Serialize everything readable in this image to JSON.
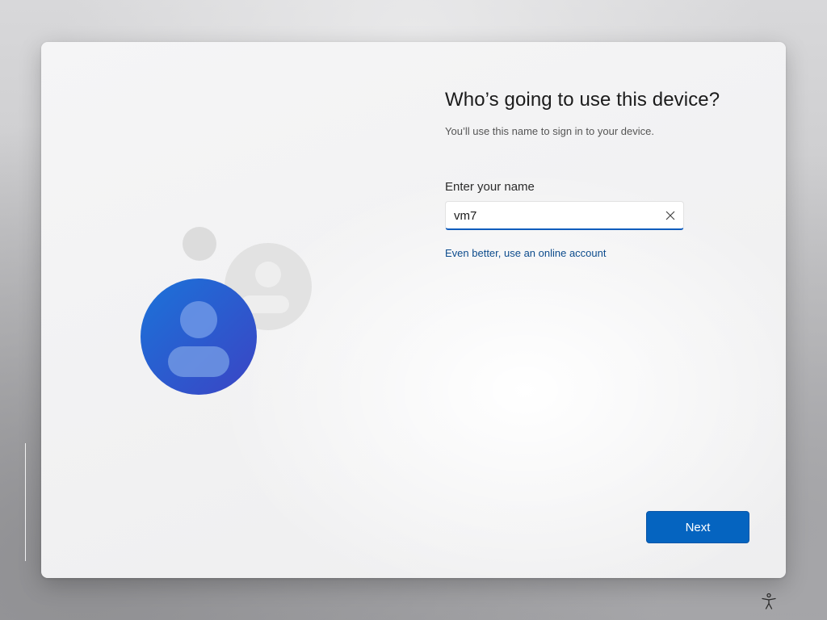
{
  "setup": {
    "title": "Who’s going to use this device?",
    "subtitle": "You’ll use this name to sign in to your device.",
    "name_label": "Enter your name",
    "name_value": "vm7",
    "online_account_link": "Even better, use an online account",
    "next_label": "Next"
  },
  "icons": {
    "clear": "close-icon",
    "accessibility": "accessibility-icon",
    "illustration": "user-accounts-illustration"
  },
  "colors": {
    "accent": "#0564c0",
    "link": "#0d4c8d",
    "avatar_primary": "#1f6fd6",
    "avatar_secondary": "#e3e3e3"
  }
}
